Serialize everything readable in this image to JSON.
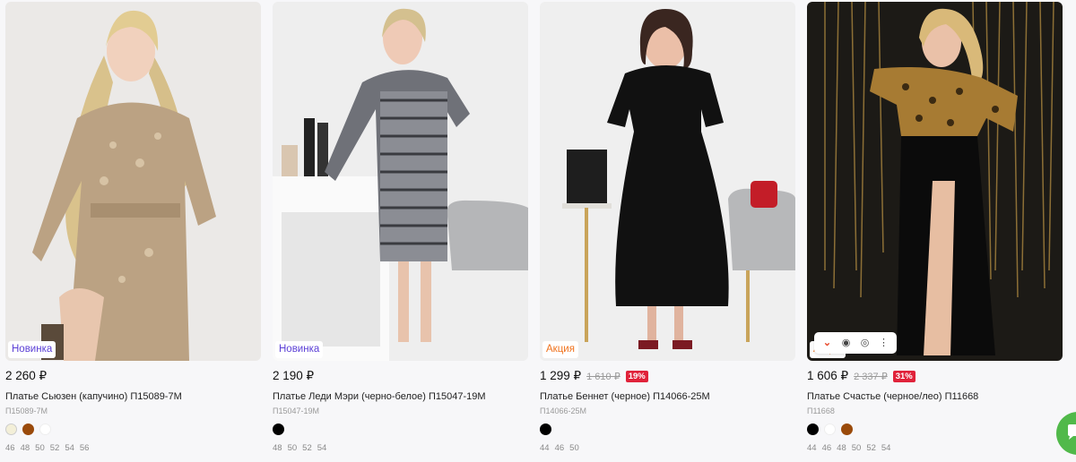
{
  "products": [
    {
      "badge": "Новинка",
      "badge_type": "new",
      "price": "2 260 ₽",
      "old_price": "",
      "discount": "",
      "title": "Платье Сьюзен (капучино) П15089-7М",
      "sku": "П15089-7М",
      "colors": [
        "#f3efd8",
        "#9a4a0a",
        "#ffffff"
      ],
      "sizes": [
        "46",
        "48",
        "50",
        "52",
        "54",
        "56"
      ],
      "photo_theme": "beige"
    },
    {
      "badge": "Новинка",
      "badge_type": "new",
      "price": "2 190 ₽",
      "old_price": "",
      "discount": "",
      "title": "Платье Леди Мэри (черно-белое) П15047-19М",
      "sku": "П15047-19М",
      "colors": [
        "#000000"
      ],
      "sizes": [
        "48",
        "50",
        "52",
        "54"
      ],
      "photo_theme": "tweed"
    },
    {
      "badge": "Акция",
      "badge_type": "sale",
      "price": "1 299 ₽",
      "old_price": "1 610 ₽",
      "discount": "19%",
      "title": "Платье Беннет (черное) П14066-25М",
      "sku": "П14066-25М",
      "colors": [
        "#000000"
      ],
      "sizes": [
        "44",
        "46",
        "50"
      ],
      "photo_theme": "black"
    },
    {
      "badge": "Акция",
      "badge_type": "sale",
      "price": "1 606 ₽",
      "old_price": "2 337 ₽",
      "discount": "31%",
      "title": "Платье Счастье (черное/лео) П11668",
      "sku": "П11668",
      "colors": [
        "#000000",
        "#ffffff",
        "#9a4a0a"
      ],
      "sizes": [
        "44",
        "46",
        "48",
        "50",
        "52",
        "54"
      ],
      "photo_theme": "leo"
    }
  ],
  "quick_actions": [
    "chevron-down-icon",
    "eye-icon",
    "camera-icon",
    "more-vertical-icon"
  ],
  "chat_button_color": "#51b94a"
}
